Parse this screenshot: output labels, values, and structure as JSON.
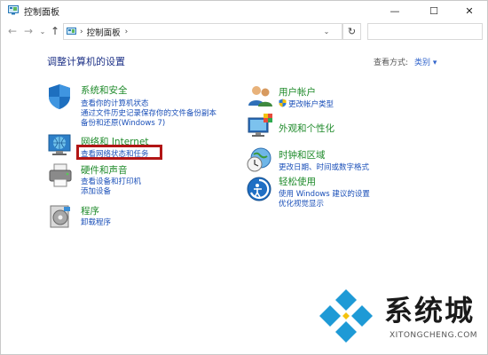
{
  "window": {
    "title": "控制面板",
    "minimize": "—",
    "maximize": "☐",
    "close": "✕"
  },
  "navbar": {
    "back": "←",
    "forward": "→",
    "recent": "⌄",
    "up": "↑",
    "sep": "›",
    "breadcrumb": "控制面板",
    "refresh": "↻",
    "search_placeholder": ""
  },
  "main": {
    "heading": "调整计算机的设置",
    "view_by_label": "查看方式:",
    "view_by_value": "类别 ▾"
  },
  "categories": {
    "system": {
      "title": "系统和安全",
      "links": [
        "查看你的计算机状态",
        "通过文件历史记录保存你的文件备份副本",
        "备份和还原(Windows 7)"
      ]
    },
    "network": {
      "title": "网络和 Internet",
      "links": [
        "查看网络状态和任务"
      ]
    },
    "hardware": {
      "title": "硬件和声音",
      "links": [
        "查看设备和打印机",
        "添加设备"
      ]
    },
    "programs": {
      "title": "程序",
      "links": [
        "卸载程序"
      ]
    },
    "user": {
      "title": "用户帐户",
      "links": [
        "更改帐户类型"
      ]
    },
    "appearance": {
      "title": "外观和个性化",
      "links": []
    },
    "clock": {
      "title": "时钟和区域",
      "links": [
        "更改日期、时间或数字格式"
      ]
    },
    "ease": {
      "title": "轻松使用",
      "links": [
        "使用 Windows 建议的设置",
        "优化视觉显示"
      ]
    }
  },
  "watermark": {
    "title": "系统城",
    "subtitle": "XITONGCHENG.COM"
  },
  "colors": {
    "category_title": "#1e8a2a",
    "link": "#1a4fb8",
    "heading": "#1e3287",
    "highlight": "#b21515",
    "logo_blue": "#1e9ad6"
  }
}
